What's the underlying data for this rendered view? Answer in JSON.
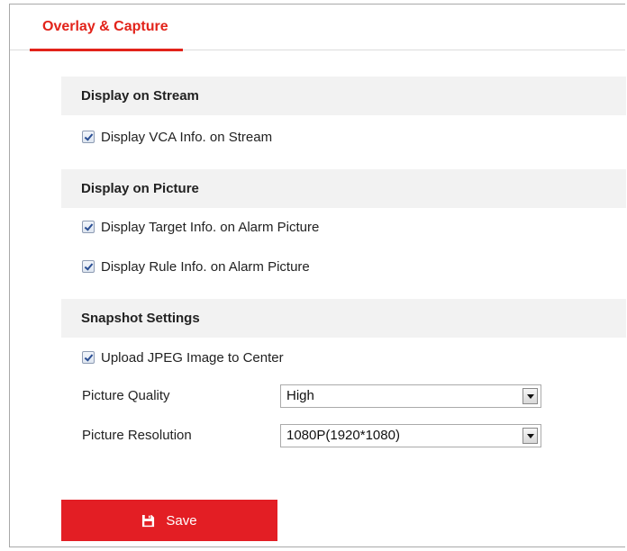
{
  "tabs": [
    {
      "label": "Overlay & Capture",
      "active": true
    }
  ],
  "sections": {
    "stream": {
      "title": "Display on Stream",
      "items": [
        {
          "label": "Display VCA Info. on Stream",
          "checked": true
        }
      ]
    },
    "picture": {
      "title": "Display on Picture",
      "items": [
        {
          "label": "Display Target Info. on Alarm Picture",
          "checked": true
        },
        {
          "label": "Display Rule Info. on Alarm Picture",
          "checked": true
        }
      ]
    },
    "snapshot": {
      "title": "Snapshot Settings",
      "items": [
        {
          "label": "Upload JPEG Image to Center",
          "checked": true
        }
      ],
      "picture_quality": {
        "label": "Picture Quality",
        "value": "High"
      },
      "picture_resolution": {
        "label": "Picture Resolution",
        "value": "1080P(1920*1080)"
      }
    }
  },
  "actions": {
    "save_label": "Save",
    "save_icon": "floppy-disk-icon"
  },
  "colors": {
    "accent": "#e2231a",
    "section_bg": "#f2f2f2"
  }
}
